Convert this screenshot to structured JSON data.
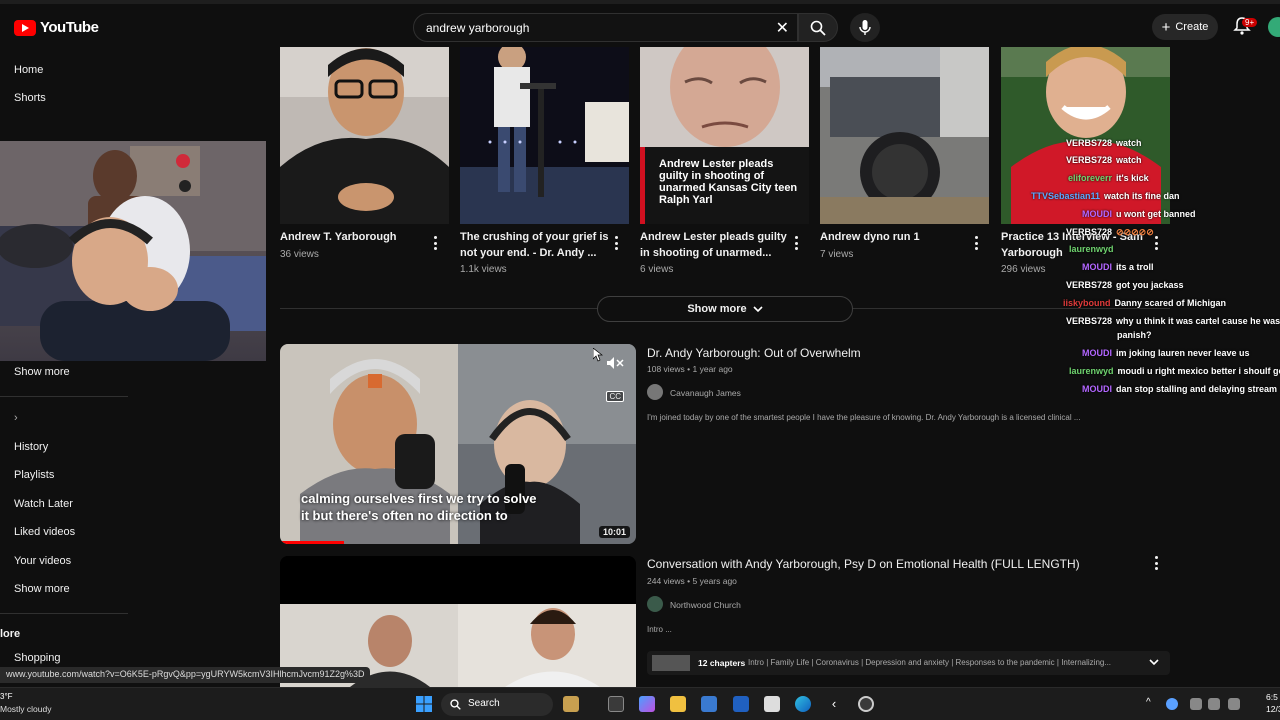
{
  "app": {
    "logo_text": "YouTube"
  },
  "search": {
    "query": "andrew yarborough"
  },
  "header": {
    "create_label": "Create",
    "notif_badge": "9+"
  },
  "sidebar": {
    "items_top": [
      "Home",
      "Shorts"
    ],
    "show_more_1": "Show more",
    "items_you": [
      "History",
      "Playlists",
      "Watch Later",
      "Liked videos",
      "Your videos"
    ],
    "show_more_2": "Show more",
    "section": "lore",
    "shopping": "Shopping"
  },
  "grid": [
    {
      "title_l1": "Andrew T. Yarborough",
      "title_l2": "",
      "meta": "36 views"
    },
    {
      "title_l1": "The crushing of your grief is",
      "title_l2": "not your end. - Dr. Andy ...",
      "meta": "1.1k views"
    },
    {
      "title_l1": "Andrew Lester pleads guilty",
      "title_l2": "in shooting of unarmed...",
      "meta": "6 views",
      "overlay": "Andrew Lester pleads guilty in shooting of unarmed Kansas City teen Ralph Yarl"
    },
    {
      "title_l1": "Andrew dyno run 1",
      "title_l2": "",
      "meta": "7 views"
    },
    {
      "title_l1": "Practice 13 Interview - Sam",
      "title_l2": "Yarborough",
      "meta": "296 views"
    }
  ],
  "show_more": "Show more",
  "videos": [
    {
      "title": "Dr. Andy Yarborough: Out of Overwhelm",
      "meta": "108 views • 1 year ago",
      "channel": "Cavanaugh James",
      "desc": "I'm joined today by one of the smartest people I have the pleasure of knowing. Dr. Andy Yarborough is a licensed clinical ...",
      "caption_l1": "calming ourselves first we try to solve",
      "caption_l2": "it but there's often no direction to",
      "duration": "10:01",
      "cc": "CC"
    },
    {
      "title": "Conversation with Andy Yarborough, Psy D on Emotional Health (FULL LENGTH)",
      "meta": "244 views • 5 years ago",
      "channel": "Northwood Church",
      "desc": "Intro ...",
      "chapters_label": "12 chapters",
      "chapters": "Intro | Family Life | Coronavirus | Depression and anxiety | Responses to the pandemic | Internalizing..."
    }
  ],
  "chat": [
    {
      "name": "VERBS728",
      "msg": "watch",
      "color": "#ffffff"
    },
    {
      "name": "VERBS728",
      "msg": "watch",
      "color": "#ffffff"
    },
    {
      "name": "eliforeverr",
      "msg": "it's kick",
      "color": "#6fd36f"
    },
    {
      "name": "TTVSebastian11",
      "msg": "watch its fine dan",
      "color": "#5aa9ff"
    },
    {
      "name": "MOUDI",
      "msg": "u wont get banned",
      "color": "#b266ff"
    },
    {
      "name": "VERBS728",
      "msg": "",
      "color": "#ffffff"
    },
    {
      "name": "laurenwyd",
      "msg": "",
      "color": "#6fd36f"
    },
    {
      "name": "MOUDI",
      "msg": "its a troll",
      "color": "#b266ff"
    },
    {
      "name": "VERBS728",
      "msg": "got you jackass",
      "color": "#ffffff"
    },
    {
      "name": "iiskybound",
      "msg": "Danny scared of Michigan",
      "color": "#e03a3a"
    },
    {
      "name": "VERBS728",
      "msg": "why u think it was cartel cause he was",
      "msg2": "panish?",
      "color": "#ffffff"
    },
    {
      "name": "MOUDI",
      "msg": "im joking lauren never leave us",
      "color": "#b266ff"
    },
    {
      "name": "laurenwyd",
      "msg": "moudi u right mexico better i shoulf go",
      "color": "#6fd36f"
    },
    {
      "name": "MOUDI",
      "msg": "dan stop stalling and delaying stream",
      "color": "#b266ff"
    }
  ],
  "status_url": "www.youtube.com/watch?v=O6K5E-pRgvQ&pp=ygURYW5kcmV3IHlhcmJvcm91Z2g%3D",
  "taskbar": {
    "weather_temp": "3°F",
    "weather_text": "Mostly cloudy",
    "search_label": "Search",
    "time": "6:5",
    "date": "12/30/"
  }
}
